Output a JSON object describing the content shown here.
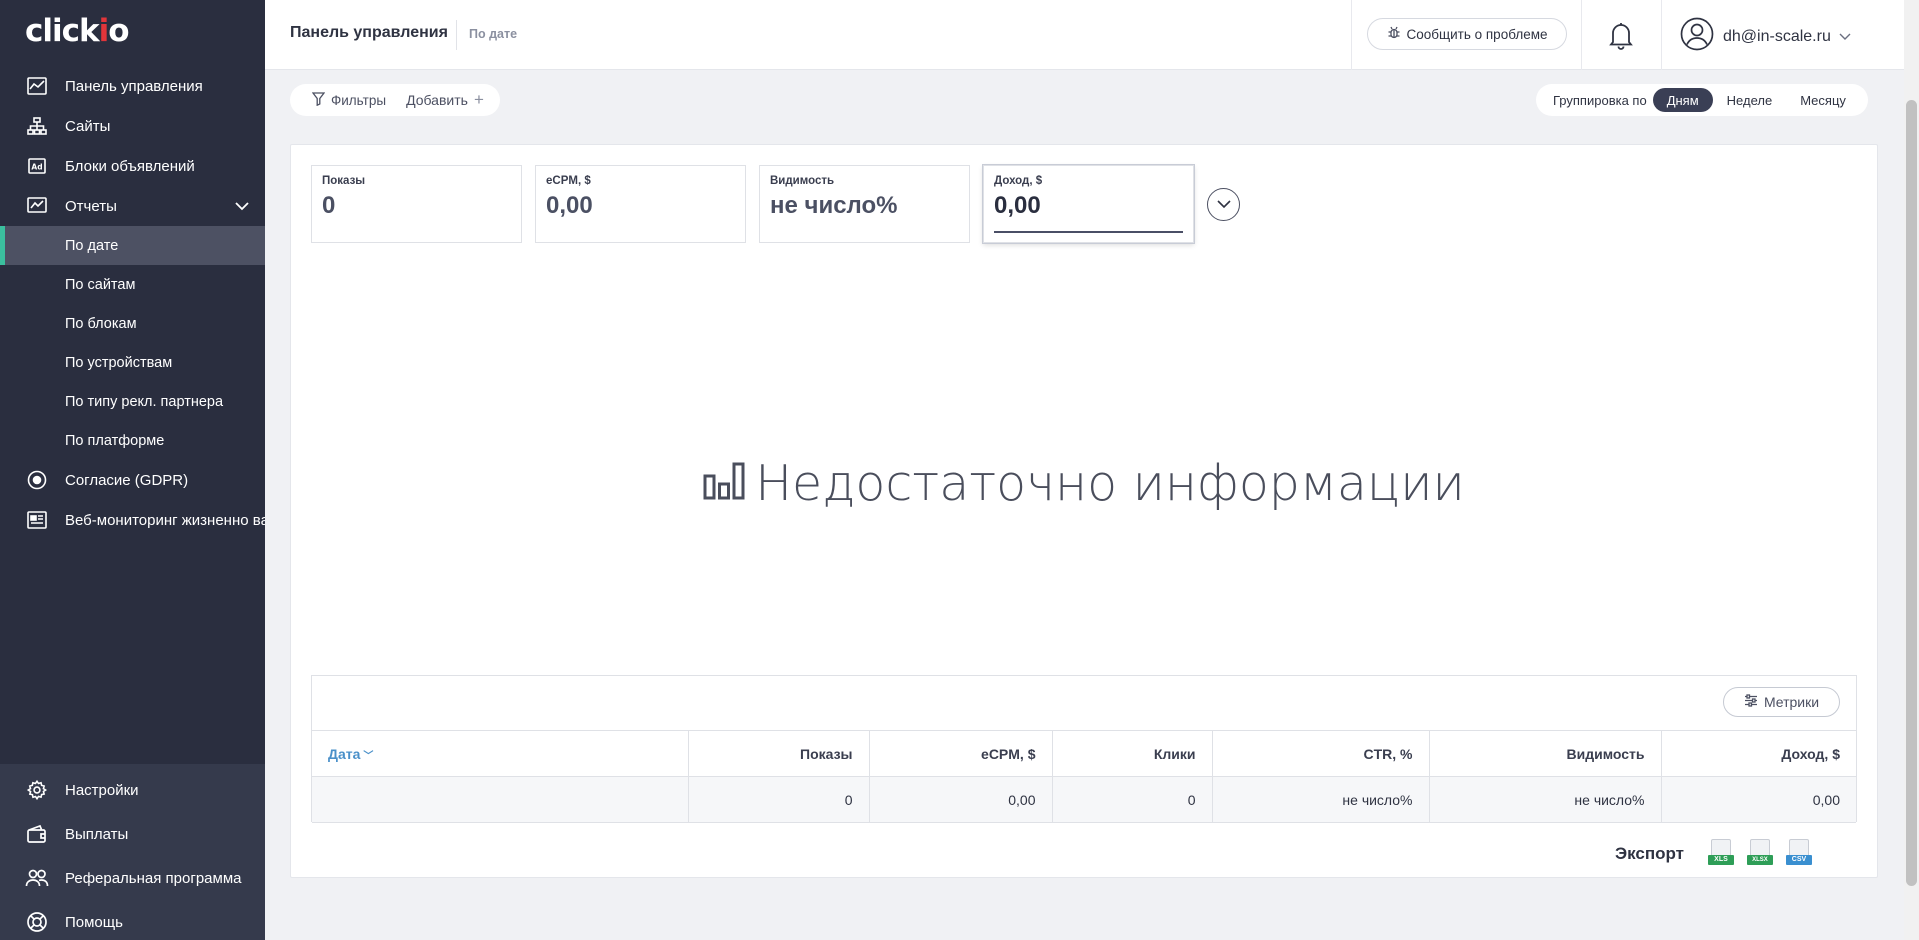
{
  "brand": {
    "logo_text_a": "click",
    "logo_text_i": "i",
    "logo_text_o": "o",
    "accent": "#3bbf9e",
    "logo_red": "#e2353a"
  },
  "sidebar": {
    "items": [
      {
        "label": "Панель управления",
        "icon": "dashboard-chart-icon"
      },
      {
        "label": "Сайты",
        "icon": "sitemap-icon"
      },
      {
        "label": "Блоки объявлений",
        "icon": "ad-block-icon"
      },
      {
        "label": "Отчеты",
        "icon": "reports-icon"
      }
    ],
    "sub_items": [
      {
        "label": "По дате",
        "active": true
      },
      {
        "label": "По сайтам"
      },
      {
        "label": "По блокам"
      },
      {
        "label": "По устройствам"
      },
      {
        "label": "По типу рекл. партнера"
      },
      {
        "label": "По платформе"
      }
    ],
    "items_after": [
      {
        "label": "Согласие (GDPR)",
        "icon": "consent-icon"
      },
      {
        "label": "Веб-мониторинг жизненно ва",
        "icon": "web-monitoring-icon"
      }
    ],
    "bottom_items": [
      {
        "label": "Настройки",
        "icon": "gear-icon"
      },
      {
        "label": "Выплаты",
        "icon": "wallet-icon"
      },
      {
        "label": "Реферальная программа",
        "icon": "users-icon"
      },
      {
        "label": "Помощь",
        "icon": "help-lifebuoy-icon"
      }
    ]
  },
  "header": {
    "title": "Панель управления",
    "breadcrumb": "По дате",
    "report_problem": "Сообщить о проблеме",
    "user_email": "dh@in-scale.ru"
  },
  "toolbar": {
    "filters": "Фильтры",
    "add": "Добавить",
    "add_plus": "+",
    "group_label": "Группировка по",
    "group_options": [
      {
        "label": "Дням",
        "active": true
      },
      {
        "label": "Неделе"
      },
      {
        "label": "Месяцу"
      }
    ]
  },
  "metrics": [
    {
      "label": "Показы",
      "value": "0"
    },
    {
      "label": "eCPM, $",
      "value": "0,00"
    },
    {
      "label": "Видимость",
      "value": "не число%"
    },
    {
      "label": "Доход, $",
      "value": "0,00",
      "active": true
    }
  ],
  "chart": {
    "empty_message": "Недостаточно информации"
  },
  "table": {
    "metrics_button": "Метрики",
    "columns": [
      "Дата",
      "Показы",
      "eCPM, $",
      "Клики",
      "CTR, %",
      "Видимость",
      "Доход, $"
    ],
    "sort_indicator": "﹀",
    "rows": [
      [
        "",
        "0",
        "0,00",
        "0",
        "не число%",
        "не число%",
        "0,00"
      ]
    ]
  },
  "export": {
    "label": "Экспорт",
    "formats": [
      {
        "label": "XLS",
        "color": "#2e9e57"
      },
      {
        "label": "XLSX",
        "color": "#2e9e57"
      },
      {
        "label": "CSV",
        "color": "#3a8fd0"
      }
    ]
  }
}
